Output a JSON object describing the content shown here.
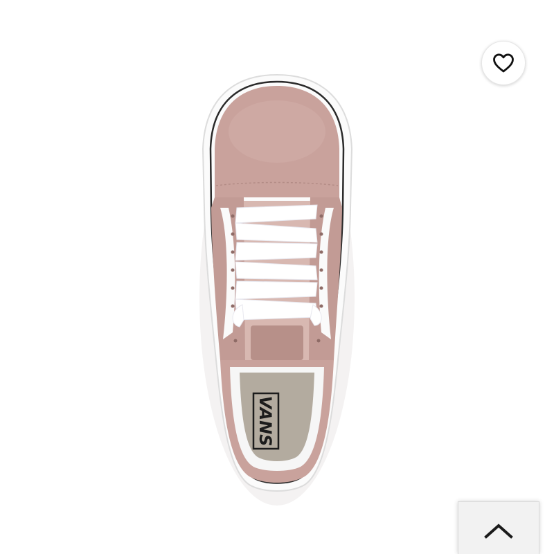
{
  "product_image": {
    "brand_mark": "VANS",
    "colors": {
      "suede": "#c9a29c",
      "canvas": "#d8b8b1",
      "laces": "#ffffff",
      "sole": "#ffffff",
      "insole": "#b3ab9f"
    }
  },
  "favorite_button": {
    "icon": "heart-icon"
  },
  "scroll_top_button": {
    "icon": "chevron-up-icon"
  }
}
